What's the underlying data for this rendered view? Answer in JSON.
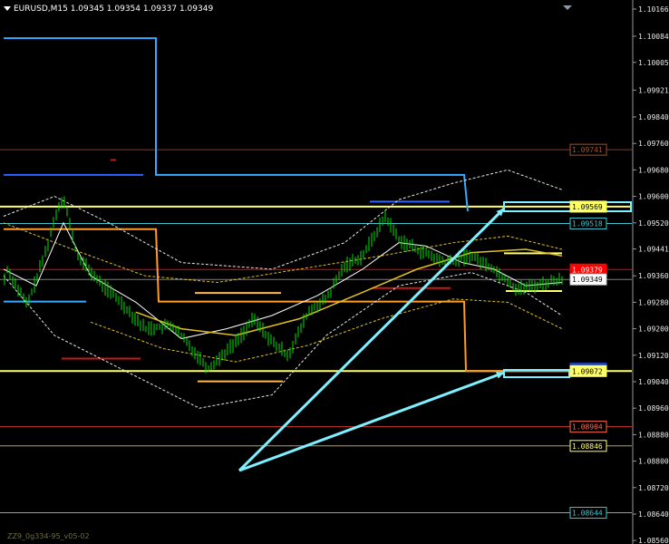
{
  "header": {
    "symbol": "EURUSD,M15",
    "ohlc": "1.09345 1.09354 1.09337 1.09349"
  },
  "footer": {
    "indicator_label": "ZZ9_0g334-95_v05-02"
  },
  "chart_data": {
    "type": "candlestick",
    "symbol": "EURUSD",
    "timeframe": "M15",
    "ylim": [
      1.08604,
      1.10182
    ],
    "grid": false,
    "y_ticks": [
      "1.10166",
      "1.10084",
      "1.10005",
      "1.09921",
      "1.09840",
      "1.09760",
      "1.09680",
      "1.09600",
      "1.09520",
      "1.09441",
      "1.09360",
      "1.09280",
      "1.09200",
      "1.09120",
      "1.09040",
      "1.08960",
      "1.08880",
      "1.08800",
      "1.08720",
      "1.08640",
      "1.08560"
    ],
    "price_labels": [
      {
        "text": "1.09741",
        "value": 1.09741,
        "color": "#a0522d",
        "text_color": "#a0522d",
        "bg": "#000000"
      },
      {
        "text": "1.09569",
        "value": 1.09569,
        "color": "#ffff66",
        "text_color": "#000000",
        "bg": "#ffff66"
      },
      {
        "text": "1.09518",
        "value": 1.09518,
        "color": "#40c4d0",
        "text_color": "#40c4d0",
        "bg": "#000000"
      },
      {
        "text": "1.09379",
        "value": 1.09379,
        "color": "#ff0000",
        "text_color": "#ffffff",
        "bg": "#ff0000"
      },
      {
        "text": "1.09349",
        "value": 1.09349,
        "color": "#c0c0c0",
        "text_color": "#000000",
        "bg": "#ffffff"
      },
      {
        "text": "1.09080",
        "value": 1.0908,
        "color": "#1f3fae",
        "text_color": "#6f86d6",
        "bg": "#1f3fae"
      },
      {
        "text": "1.09072",
        "value": 1.09072,
        "color": "#ffff66",
        "text_color": "#000000",
        "bg": "#ffff66"
      },
      {
        "text": "1.08904",
        "value": 1.08904,
        "color": "#ff6a4d",
        "text_color": "#ff6a4d",
        "bg": "#000000"
      },
      {
        "text": "1.08846",
        "value": 1.08846,
        "color": "#ffff66",
        "text_color": "#ffff66",
        "bg": "#000000"
      },
      {
        "text": "1.08644",
        "value": 1.08644,
        "color": "#40c4d0",
        "text_color": "#40c4d0",
        "bg": "#000000"
      }
    ],
    "horizontal_lines": [
      {
        "value": 1.09741,
        "color": "#8b3a1a"
      },
      {
        "value": 1.09569,
        "color": "#ffff66",
        "bold": true
      },
      {
        "value": 1.09518,
        "color": "#40c4d0"
      },
      {
        "value": 1.09379,
        "color": "#ff0000"
      },
      {
        "value": 1.09349,
        "color": "#808080"
      },
      {
        "value": 1.09072,
        "color": "#ffff66",
        "bold": true
      },
      {
        "value": 1.08904,
        "color": "#c83a2a"
      },
      {
        "value": 1.08846,
        "color": "#b8a64a"
      },
      {
        "value": 1.08644,
        "color": "#40c4d0"
      }
    ],
    "colors": {
      "background": "#000000",
      "candle": "#00e000",
      "upper_channel": "#3aa8ff",
      "lower_channel": "#ff9a2e",
      "ma_white": "#ffffff",
      "ma_yellow": "#e0c020",
      "arrows": "#7ef0ff"
    }
  }
}
